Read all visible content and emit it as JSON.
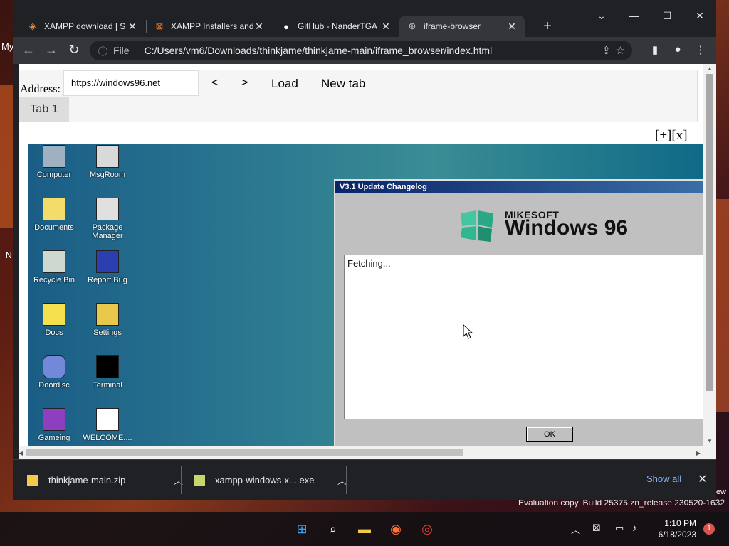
{
  "browser": {
    "tabs": [
      {
        "title": "XAMPP download | S",
        "icon": "xampp-icon"
      },
      {
        "title": "XAMPP Installers and",
        "icon": "xampp-icon"
      },
      {
        "title": "GitHub - NanderTGA",
        "icon": "github-icon"
      },
      {
        "title": "iframe-browser",
        "icon": "globe-icon",
        "active": true
      }
    ],
    "url_prefix": "File",
    "url": "C:/Users/vm6/Downloads/thinkjame/thinkjame-main/iframe_browser/index.html"
  },
  "page": {
    "address_label": "Address:",
    "address_value": "https://windows96.net",
    "back_label": "<",
    "forward_label": ">",
    "load_label": "Load",
    "newtab_label": "New tab",
    "tab1_label": "Tab 1",
    "tab_controls": "[+][x]"
  },
  "win96": {
    "desktop_icons": [
      {
        "label": "Computer"
      },
      {
        "label": "MsgRoom"
      },
      {
        "label": "Documents"
      },
      {
        "label": "Package Manager"
      },
      {
        "label": "Recycle Bin"
      },
      {
        "label": "Report Bug"
      },
      {
        "label": "Docs"
      },
      {
        "label": "Settings"
      },
      {
        "label": "Doordisc"
      },
      {
        "label": "Terminal"
      },
      {
        "label": "Gameing"
      },
      {
        "label": "WELCOME...."
      }
    ],
    "dialog": {
      "title": "V3.1 Update Changelog",
      "brand_top": "MIKESOFT",
      "brand_main": "Windows 96",
      "content": "Fetching...",
      "ok_label": "OK"
    }
  },
  "downloads": {
    "items": [
      {
        "name": "thinkjame-main.zip"
      },
      {
        "name": "xampp-windows-x....exe"
      }
    ],
    "show_all": "Show all"
  },
  "desktop": {
    "peek_left": "My",
    "peek_mid": "N",
    "peek_right": "ew",
    "evaluation": "Evaluation copy. Build 25375.zn_release.230520-1632"
  },
  "taskbar": {
    "time": "1:10 PM",
    "date": "6/18/2023",
    "notifications": "1"
  },
  "colors": {
    "chrome_dark": "#202124",
    "toolbar": "#35363a",
    "win96_title_start": "#0a246a",
    "desktop_teal": "#2e7d92",
    "link_blue": "#8ab4f8"
  }
}
